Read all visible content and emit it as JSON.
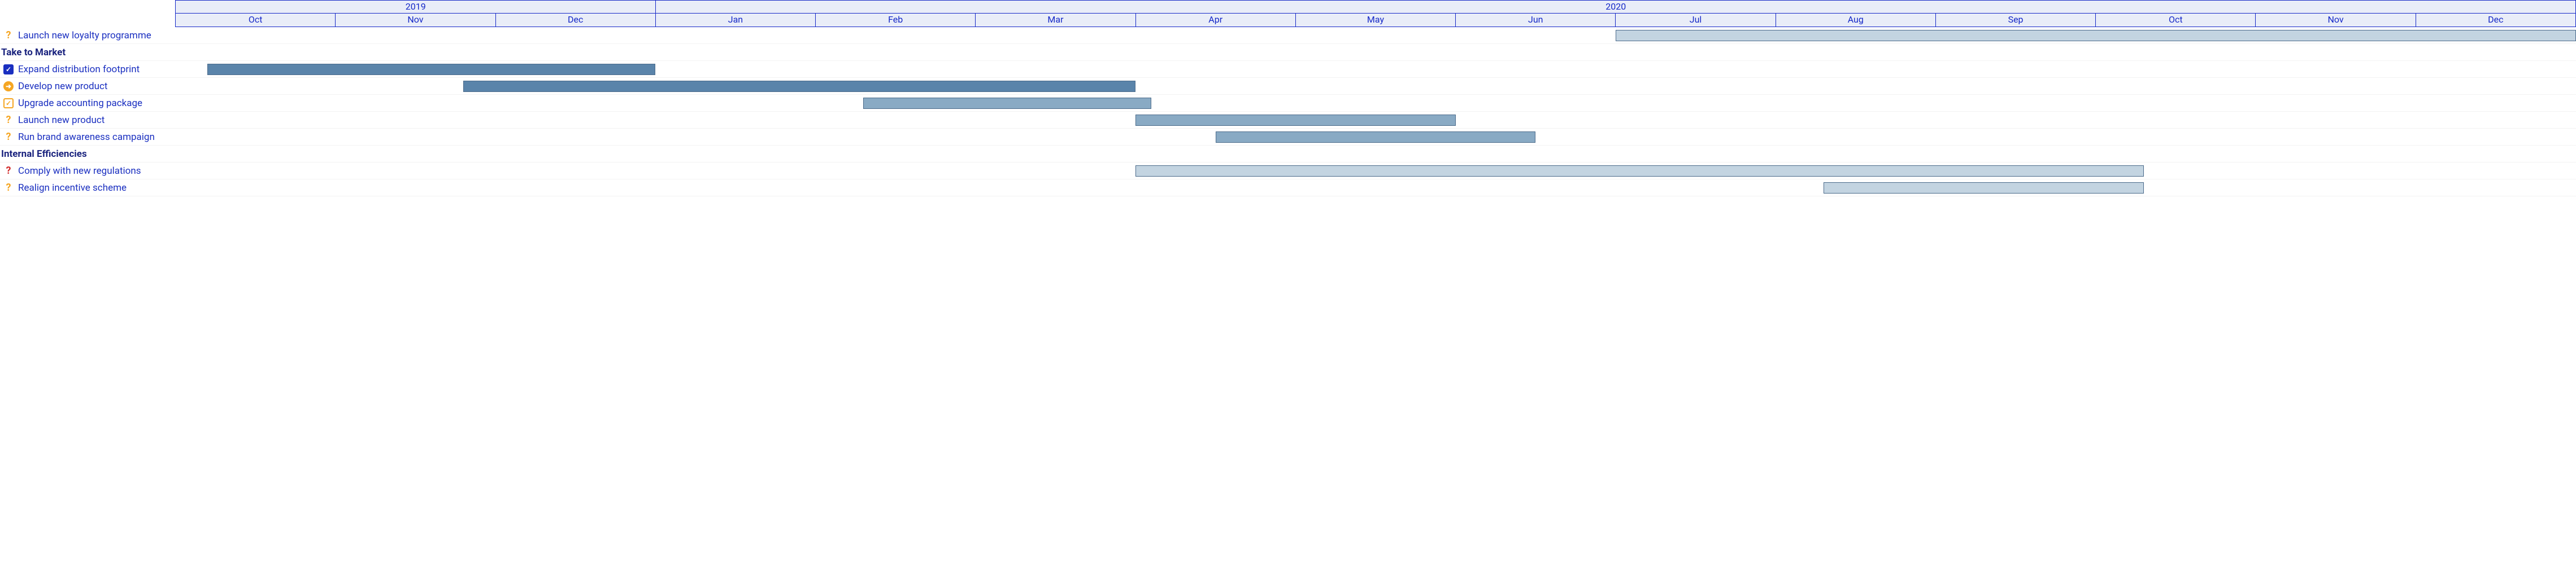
{
  "timeline": {
    "years": [
      {
        "label": "2019",
        "months": 3
      },
      {
        "label": "2020",
        "months": 12
      }
    ],
    "months": [
      "Oct",
      "Nov",
      "Dec",
      "Jan",
      "Feb",
      "Mar",
      "Apr",
      "May",
      "Jun",
      "Jul",
      "Aug",
      "Sep",
      "Oct",
      "Nov",
      "Dec"
    ]
  },
  "rows": [
    {
      "type": "task",
      "icon": "question",
      "label": "Launch new loyalty programme",
      "bar": {
        "start": 9,
        "end": 15,
        "style": "light"
      }
    },
    {
      "type": "section",
      "label": "Take to Market"
    },
    {
      "type": "task",
      "icon": "check",
      "label": "Expand distribution footprint",
      "bar": {
        "start": 0.2,
        "end": 3,
        "style": "dark"
      }
    },
    {
      "type": "task",
      "icon": "arrow",
      "label": "Develop new product",
      "bar": {
        "start": 1.8,
        "end": 6,
        "style": "dark"
      }
    },
    {
      "type": "task",
      "icon": "tickbox",
      "label": "Upgrade accounting package",
      "bar": {
        "start": 4.3,
        "end": 6.1,
        "style": "med"
      }
    },
    {
      "type": "task",
      "icon": "question",
      "label": "Launch new product",
      "bar": {
        "start": 6,
        "end": 8,
        "style": "med"
      }
    },
    {
      "type": "task",
      "icon": "question",
      "label": "Run brand awareness campaign",
      "bar": {
        "start": 6.5,
        "end": 8.5,
        "style": "med"
      }
    },
    {
      "type": "section",
      "label": "Internal Efficiencies"
    },
    {
      "type": "task",
      "icon": "question-red",
      "label": "Comply with new regulations",
      "bar": {
        "start": 6,
        "end": 12.3,
        "style": "light"
      }
    },
    {
      "type": "task",
      "icon": "question",
      "label": "Realign incentive scheme",
      "bar": {
        "start": 10.3,
        "end": 12.3,
        "style": "light"
      }
    }
  ],
  "chart_data": {
    "type": "bar",
    "title": "",
    "xlabel": "",
    "ylabel": "",
    "x_range": [
      "2019-10",
      "2020-12"
    ],
    "series": [
      {
        "name": "Launch new loyalty programme",
        "group": "",
        "status": "pending",
        "start": "2020-07",
        "end": "2020-12"
      },
      {
        "name": "Expand distribution footprint",
        "group": "Take to Market",
        "status": "done",
        "start": "2019-10",
        "end": "2019-12"
      },
      {
        "name": "Develop new product",
        "group": "Take to Market",
        "status": "in-progress",
        "start": "2019-11",
        "end": "2020-03"
      },
      {
        "name": "Upgrade accounting package",
        "group": "Take to Market",
        "status": "approved",
        "start": "2020-02",
        "end": "2020-04"
      },
      {
        "name": "Launch new product",
        "group": "Take to Market",
        "status": "pending",
        "start": "2020-04",
        "end": "2020-05"
      },
      {
        "name": "Run brand awareness campaign",
        "group": "Take to Market",
        "status": "pending",
        "start": "2020-04",
        "end": "2020-06"
      },
      {
        "name": "Comply with new regulations",
        "group": "Internal Efficiencies",
        "status": "at-risk",
        "start": "2020-04",
        "end": "2020-10"
      },
      {
        "name": "Realign incentive scheme",
        "group": "Internal Efficiencies",
        "status": "pending",
        "start": "2020-08",
        "end": "2020-10"
      }
    ]
  }
}
